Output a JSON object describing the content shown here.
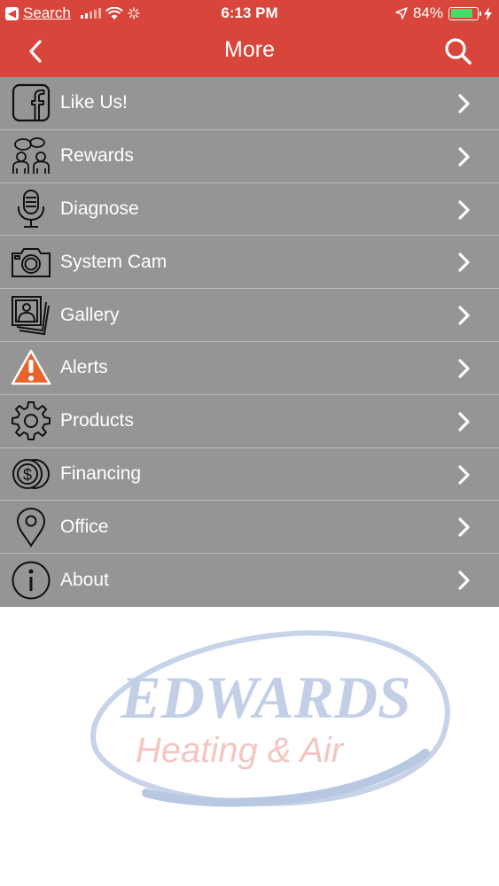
{
  "status_bar": {
    "back_app": "Search",
    "time": "6:13 PM",
    "battery_percent": "84%",
    "battery_level": 0.84
  },
  "nav": {
    "title": "More",
    "back_icon": "chevron-left-icon",
    "search_icon": "search-icon"
  },
  "menu": {
    "items": [
      {
        "label": "Like Us!",
        "icon": "facebook-icon"
      },
      {
        "label": "Rewards",
        "icon": "people-icon"
      },
      {
        "label": "Diagnose",
        "icon": "microphone-icon"
      },
      {
        "label": "System Cam",
        "icon": "camera-icon"
      },
      {
        "label": "Gallery",
        "icon": "photos-icon"
      },
      {
        "label": "Alerts",
        "icon": "warning-icon"
      },
      {
        "label": "Products",
        "icon": "gear-icon"
      },
      {
        "label": "Financing",
        "icon": "coins-icon"
      },
      {
        "label": "Office",
        "icon": "map-pin-icon"
      },
      {
        "label": "About",
        "icon": "info-icon"
      }
    ]
  },
  "logo": {
    "line1": "EDWARDS",
    "line2": "Heating & Air"
  },
  "colors": {
    "header": "#d9453a",
    "menu_bg": "#959595",
    "alert_orange": "#e8642c",
    "logo_blue": "#9fb3d6",
    "logo_red": "#f2b0ab"
  }
}
